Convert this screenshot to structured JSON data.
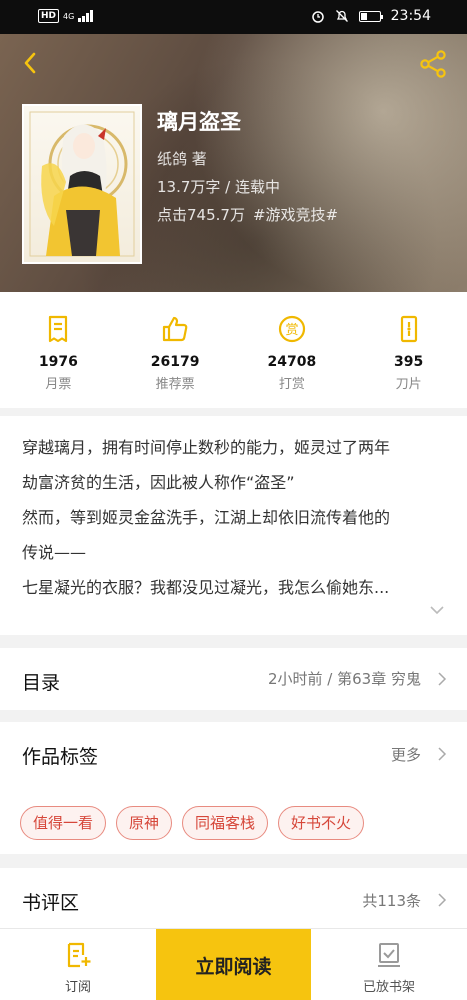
{
  "status_bar": {
    "hd": "HD",
    "network": "4G",
    "time": "23:54"
  },
  "book": {
    "title": "璃月盗圣",
    "author": "纸鸽  著",
    "words_status": "13.7万字 / 连载中",
    "clicks": "点击745.7万",
    "category": "#游戏竞技#"
  },
  "stats": [
    {
      "icon": "ticket-icon",
      "value": "1976",
      "label": "月票"
    },
    {
      "icon": "thumbs-up-icon",
      "value": "26179",
      "label": "推荐票"
    },
    {
      "icon": "reward-coin-icon",
      "value": "24708",
      "label": "打赏"
    },
    {
      "icon": "blade-icon",
      "value": "395",
      "label": "刀片"
    }
  ],
  "description": {
    "lines": [
      "穿越璃月，拥有时间停止数秒的能力，姬灵过了两年",
      "劫富济贫的生活，因此被人称作“盗圣”",
      "然而，等到姬灵金盆洗手，江湖上却依旧流传着他的",
      "传说——",
      "七星凝光的衣服？我都没见过凝光，我怎么偷她东..."
    ]
  },
  "toc": {
    "title": "目录",
    "latest": "2小时前 / 第63章  穷鬼"
  },
  "tags_section": {
    "title": "作品标签",
    "more": "更多",
    "tags": [
      "值得一看",
      "原神",
      "同福客栈",
      "好书不火"
    ]
  },
  "reviews": {
    "title": "书评区",
    "count": "共113条"
  },
  "bottom_bar": {
    "subscribe": "订阅",
    "read_now": "立即阅读",
    "shelf": "已放书架"
  },
  "colors": {
    "accent": "#f6c40f",
    "icon_yellow": "#f0b800",
    "tag_red": "#d6473a"
  }
}
